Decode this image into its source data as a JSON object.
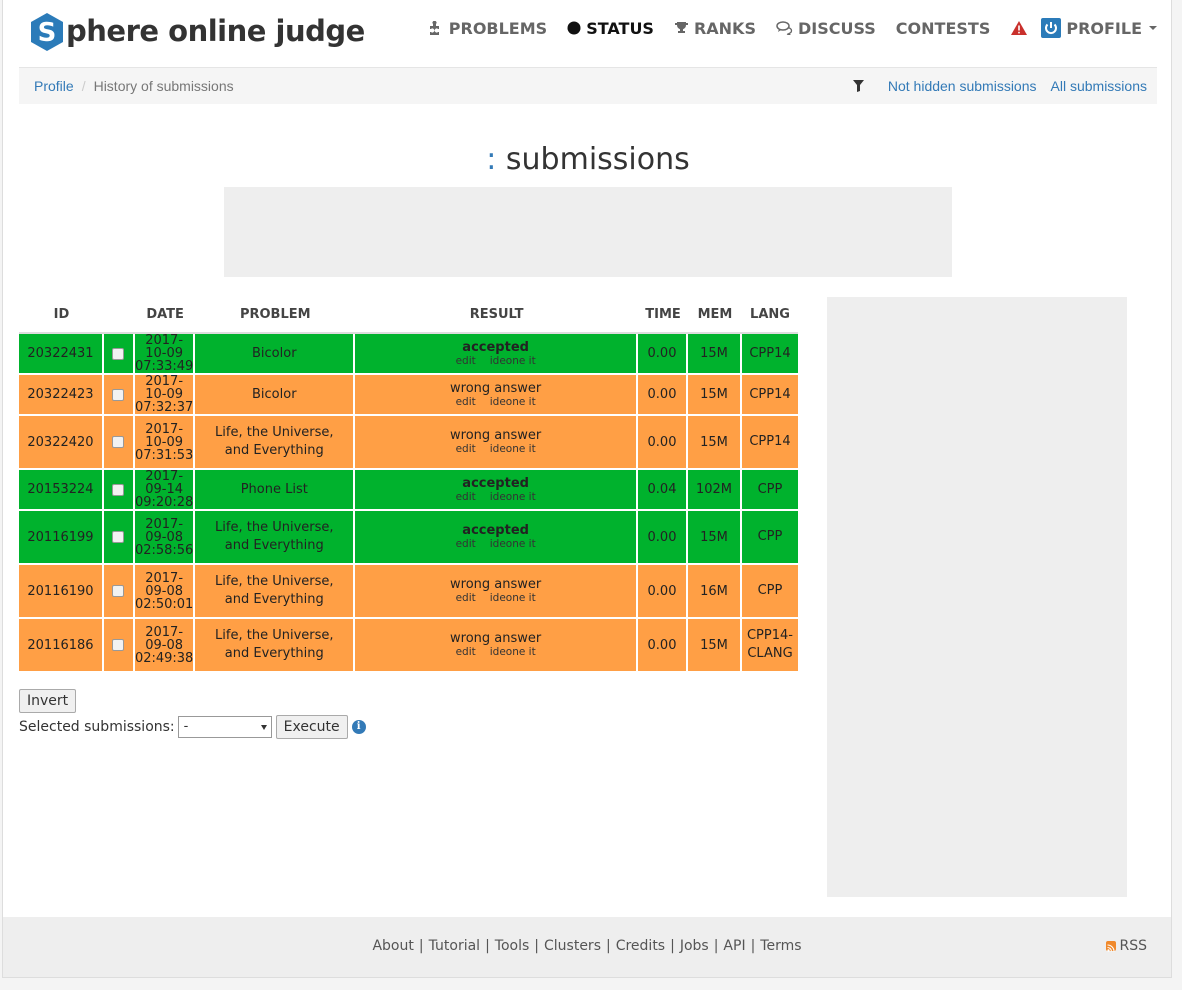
{
  "brand": {
    "logo_letter": "S",
    "name": "phere online judge",
    "hex_color": "#2b7bb9"
  },
  "nav": {
    "problems": "PROBLEMS",
    "status": "STATUS",
    "ranks": "RANKS",
    "discuss": "DISCUSS",
    "contests": "CONTESTS",
    "profile": "PROFILE"
  },
  "breadcrumb": {
    "profile": "Profile",
    "separator": "/",
    "current": "History of submissions"
  },
  "filters": {
    "not_hidden": "Not hidden submissions",
    "all": "All submissions"
  },
  "title": {
    "colon": ":",
    "text": "submissions"
  },
  "table": {
    "headers": {
      "id": "ID",
      "date": "DATE",
      "problem": "PROBLEM",
      "result": "RESULT",
      "time": "TIME",
      "mem": "MEM",
      "lang": "LANG"
    },
    "edit_label": "edit",
    "ideone_label": "ideone it",
    "rows": [
      {
        "id": "20322431",
        "date": "2017-10-09",
        "time_of_day": "07:33:49",
        "problem_line1": "Bicolor",
        "problem_line2": "",
        "result": "accepted",
        "status": "ok",
        "time": "0.00",
        "mem": "15M",
        "lang_line1": "CPP14",
        "lang_line2": ""
      },
      {
        "id": "20322423",
        "date": "2017-10-09",
        "time_of_day": "07:32:37",
        "problem_line1": "Bicolor",
        "problem_line2": "",
        "result": "wrong answer",
        "status": "wa",
        "time": "0.00",
        "mem": "15M",
        "lang_line1": "CPP14",
        "lang_line2": ""
      },
      {
        "id": "20322420",
        "date": "2017-10-09",
        "time_of_day": "07:31:53",
        "problem_line1": "Life, the Universe,",
        "problem_line2": "and Everything",
        "result": "wrong answer",
        "status": "wa",
        "time": "0.00",
        "mem": "15M",
        "lang_line1": "CPP14",
        "lang_line2": ""
      },
      {
        "id": "20153224",
        "date": "2017-09-14",
        "time_of_day": "09:20:28",
        "problem_line1": "Phone List",
        "problem_line2": "",
        "result": "accepted",
        "status": "ok",
        "time": "0.04",
        "mem": "102M",
        "lang_line1": "CPP",
        "lang_line2": ""
      },
      {
        "id": "20116199",
        "date": "2017-09-08",
        "time_of_day": "02:58:56",
        "problem_line1": "Life, the Universe,",
        "problem_line2": "and Everything",
        "result": "accepted",
        "status": "ok",
        "time": "0.00",
        "mem": "15M",
        "lang_line1": "CPP",
        "lang_line2": ""
      },
      {
        "id": "20116190",
        "date": "2017-09-08",
        "time_of_day": "02:50:01",
        "problem_line1": "Life, the Universe,",
        "problem_line2": "and Everything",
        "result": "wrong answer",
        "status": "wa",
        "time": "0.00",
        "mem": "16M",
        "lang_line1": "CPP",
        "lang_line2": ""
      },
      {
        "id": "20116186",
        "date": "2017-09-08",
        "time_of_day": "02:49:38",
        "problem_line1": "Life, the Universe,",
        "problem_line2": "and Everything",
        "result": "wrong answer",
        "status": "wa",
        "time": "0.00",
        "mem": "15M",
        "lang_line1": "CPP14-",
        "lang_line2": "CLANG"
      }
    ]
  },
  "controls": {
    "invert": "Invert",
    "selected_label": "Selected submissions:",
    "selected_value": "-",
    "execute": "Execute",
    "info": "i"
  },
  "footer": {
    "links": [
      "About",
      "Tutorial",
      "Tools",
      "Clusters",
      "Credits",
      "Jobs",
      "API",
      "Terms"
    ],
    "rss": "RSS"
  },
  "colors": {
    "accepted": "#00b22d",
    "wrong_answer": "#ff9f45",
    "link": "#337ab7",
    "warning": "#c9302c"
  }
}
